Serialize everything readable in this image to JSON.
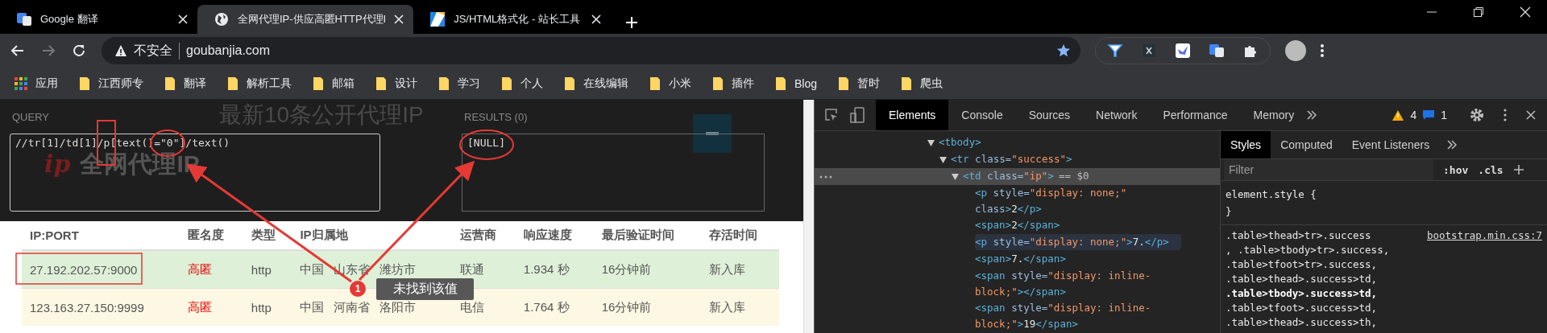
{
  "tabs": [
    {
      "title": "Google 翻译",
      "selected": false
    },
    {
      "title": "全网代理IP-供应高匿HTTP代理I",
      "selected": true
    },
    {
      "title": "JS/HTML格式化 - 站长工具",
      "selected": false
    }
  ],
  "address_bar": {
    "security": "不安全",
    "url": "goubanjia.com"
  },
  "bookmarks": [
    {
      "label": "应用",
      "kind": "apps"
    },
    {
      "label": "江西师专",
      "kind": "folder"
    },
    {
      "label": "翻译",
      "kind": "folder"
    },
    {
      "label": "解析工具",
      "kind": "folder"
    },
    {
      "label": "邮箱",
      "kind": "folder"
    },
    {
      "label": "设计",
      "kind": "folder"
    },
    {
      "label": "学习",
      "kind": "folder"
    },
    {
      "label": "个人",
      "kind": "folder"
    },
    {
      "label": "在线编辑",
      "kind": "folder"
    },
    {
      "label": "小米",
      "kind": "folder"
    },
    {
      "label": "插件",
      "kind": "folder"
    },
    {
      "label": "Blog",
      "kind": "folder"
    },
    {
      "label": "暂时",
      "kind": "folder"
    },
    {
      "label": "爬虫",
      "kind": "folder"
    }
  ],
  "page": {
    "heading": "最新10条公开代理IP",
    "logo_mark": "ip",
    "logo": "全网代理IP",
    "xpath_helper": {
      "query_label": "QUERY",
      "query": "//tr[1]/td[1]/p[text()=\"0\"]/text()",
      "results_label": "RESULTS (0)",
      "results": "[NULL]"
    },
    "table": {
      "columns": [
        "IP:PORT",
        "匿名度",
        "类型",
        "IP归属地",
        "运营商",
        "响应速度",
        "最后验证时间",
        "存活时间"
      ],
      "rows": [
        {
          "kind": "success",
          "ip": "27.192.202.57:9000",
          "anonymity": "高匿",
          "type": "http",
          "location": [
            "中国",
            "山东省",
            "潍坊市"
          ],
          "isp": "联通",
          "speed": "1.934 秒",
          "verified": "16分钟前",
          "alive": "新入库"
        },
        {
          "kind": "warning",
          "ip": "123.163.27.150:9999",
          "anonymity": "高匿",
          "type": "http",
          "location": [
            "中国",
            "河南省",
            "洛阳市"
          ],
          "isp": "电信",
          "speed": "1.764 秒",
          "verified": "16分钟前",
          "alive": "新入库"
        }
      ]
    },
    "annotation": {
      "number": "1",
      "text": "未找到该值"
    }
  },
  "devtools": {
    "tabs": [
      {
        "label": "Elements",
        "selected": true
      },
      {
        "label": "Console",
        "selected": false
      },
      {
        "label": "Sources",
        "selected": false
      },
      {
        "label": "Network",
        "selected": false
      },
      {
        "label": "Performance",
        "selected": false
      },
      {
        "label": "Memory",
        "selected": false
      }
    ],
    "warnings": "4",
    "messages": "1",
    "dom_tree": [
      {
        "markup": "<tbody>",
        "expanded": true,
        "selected": false,
        "hovered": false,
        "children": [
          {
            "markup": "<tr class=\"success\">",
            "expanded": true,
            "selected": false,
            "hovered": false,
            "children": [
              {
                "markup": "<td class=\"ip\">",
                "console_ref": "== $0",
                "expanded": true,
                "selected": true,
                "hovered": false,
                "children": [
                  {
                    "markup": "<p style=\"display: none;\" class>2</p>",
                    "selected": false,
                    "hovered": false
                  },
                  {
                    "markup": "<span>2</span>",
                    "selected": false,
                    "hovered": false
                  },
                  {
                    "markup": "<p style=\"display: none;\">7.</p>",
                    "selected": false,
                    "hovered": true
                  },
                  {
                    "markup": "<span>7.</span>",
                    "selected": false,
                    "hovered": false
                  },
                  {
                    "markup": "<span style=\"display: inline-block;\"></span>",
                    "selected": false,
                    "hovered": false
                  },
                  {
                    "markup": "<span style=\"display: inline-block;\">19</span>",
                    "selected": false,
                    "hovered": false
                  }
                ]
              }
            ]
          }
        ]
      }
    ],
    "styles_tabs": [
      {
        "label": "Styles",
        "selected": true
      },
      {
        "label": "Computed",
        "selected": false
      },
      {
        "label": "Event Listeners",
        "selected": false
      }
    ],
    "filter_placeholder": "Filter",
    "hov": ":hov",
    "cls": ".cls",
    "element_style": [
      "element.style {",
      "}"
    ],
    "rule_source": "bootstrap.min.css:7",
    "rule_selectors": [
      {
        "text": ".table>thead>tr>.success",
        "matched": false
      },
      {
        "text": ", .table>tbody>tr>.success,",
        "matched": false
      },
      {
        "text": ".table>tfoot>tr>.success,",
        "matched": false
      },
      {
        "text": ".table>thead>.success>td,",
        "matched": false
      },
      {
        "text": ".table>tbody>.success>td,",
        "matched": true
      },
      {
        "text": ".table>tfoot>.success>td,",
        "matched": false
      },
      {
        "text": ".table>thead>.success>th,",
        "matched": false
      }
    ]
  }
}
